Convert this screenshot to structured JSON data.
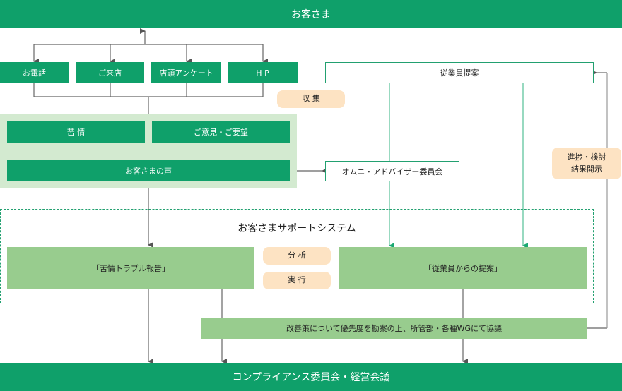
{
  "header": {
    "label": "お客さま"
  },
  "channels": [
    {
      "label": "お電話"
    },
    {
      "label": "ご来店"
    },
    {
      "label": "店頭アンケート"
    },
    {
      "label": "H P"
    }
  ],
  "employee_proposal": {
    "label": "従業員提案"
  },
  "collect_tag": {
    "label": "収 集"
  },
  "voice_panel": {
    "complaint": "苦 情",
    "opinion": "ご意見・ご要望",
    "voice": "お客さまの声"
  },
  "omni_committee": {
    "label": "オムニ・アドバイザー委員会"
  },
  "progress_tag": {
    "line1": "進捗・検討",
    "line2": "結果開示"
  },
  "support_system": {
    "title": "お客さまサポートシステム",
    "complaint_report": "「苦情トラブル報告」",
    "employee_box": "「従業員からの提案」",
    "analyze": "分 析",
    "execute": "実 行"
  },
  "discussion": {
    "label": "改善策について優先度を勘案の上、所管部・各種WGにて協議"
  },
  "footer": {
    "label": "コンプライアンス委員会・経営会議"
  }
}
